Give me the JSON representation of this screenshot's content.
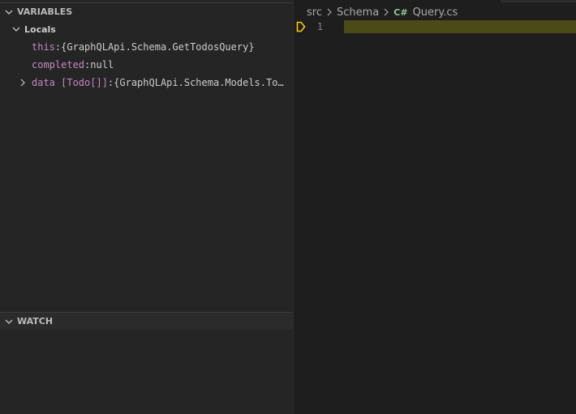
{
  "variables_panel": {
    "title": "VARIABLES",
    "scope": "Locals",
    "items": [
      {
        "name": "this",
        "separator": ": ",
        "value": "{GraphQLApi.Schema.GetTodosQuery}"
      },
      {
        "name": "completed",
        "separator": ": ",
        "value": "null"
      },
      {
        "name": "data [Todo[]]",
        "separator": ": ",
        "value": "{GraphQLApi.Schema.Models.Tod…"
      }
    ]
  },
  "watch_panel": {
    "title": "WATCH"
  },
  "editor": {
    "breadcrumb": [
      "src",
      "Schema",
      "Query.cs"
    ],
    "file_icon": "C#",
    "line_number": "1"
  },
  "colors": {
    "variable_name": "#c586c0",
    "current_line_highlight": "#4b4b18",
    "breakpoint_arrow": "#ffcc00",
    "csharp_icon": "#8dc891"
  },
  "icons": {
    "collapse": "chevron-down-icon",
    "expand": "chevron-right-icon",
    "breadcrumb_separator": "chevron-right-icon",
    "file_type": "csharp-file-icon",
    "stack_frame": "debug-stackframe-icon"
  }
}
